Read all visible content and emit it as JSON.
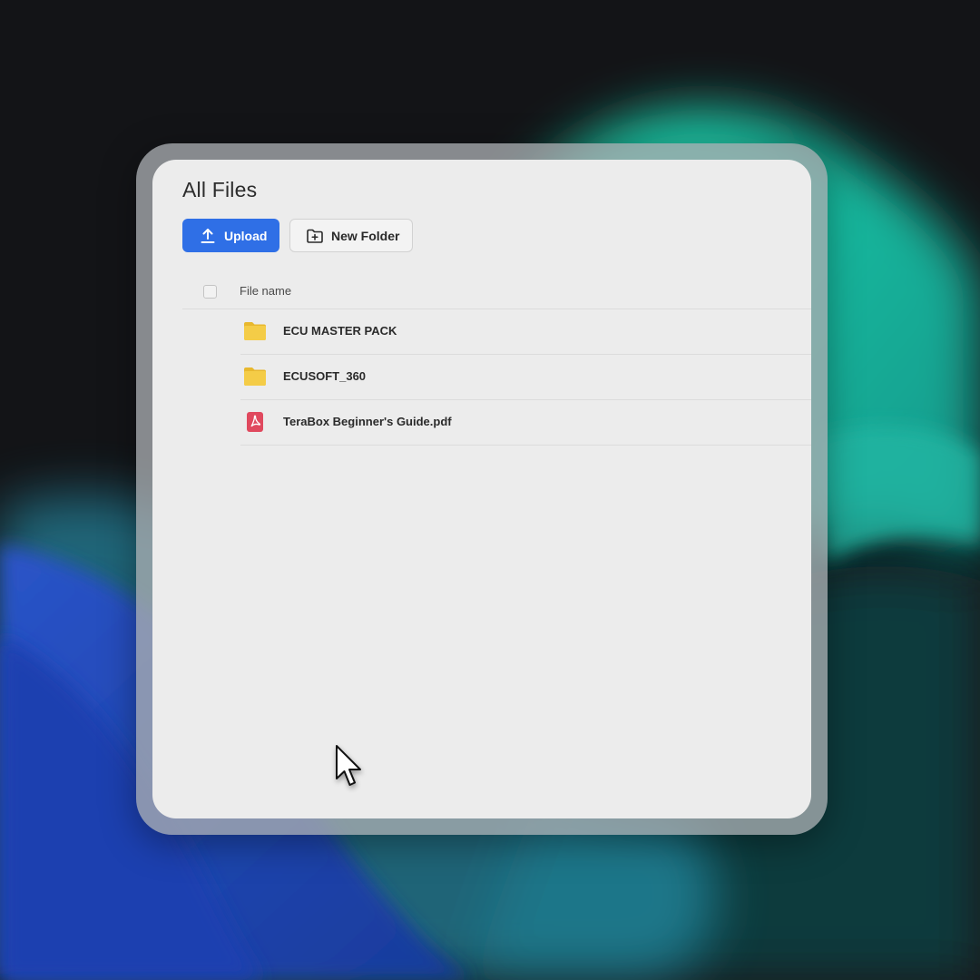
{
  "header": {
    "title": "All Files"
  },
  "toolbar": {
    "upload_label": "Upload",
    "new_folder_label": "New Folder"
  },
  "list": {
    "column_filename": "File name",
    "items": [
      {
        "name": "ECU MASTER PACK",
        "icon": "folder-icon"
      },
      {
        "name": "ECUSOFT_360",
        "icon": "folder-icon"
      },
      {
        "name": "TeraBox Beginner's Guide.pdf",
        "icon": "pdf-icon"
      }
    ]
  },
  "colors": {
    "accent": "#2f6fe6",
    "folder": "#f2c53d",
    "pdf": "#e0495e",
    "panel_bg": "#ececec"
  }
}
